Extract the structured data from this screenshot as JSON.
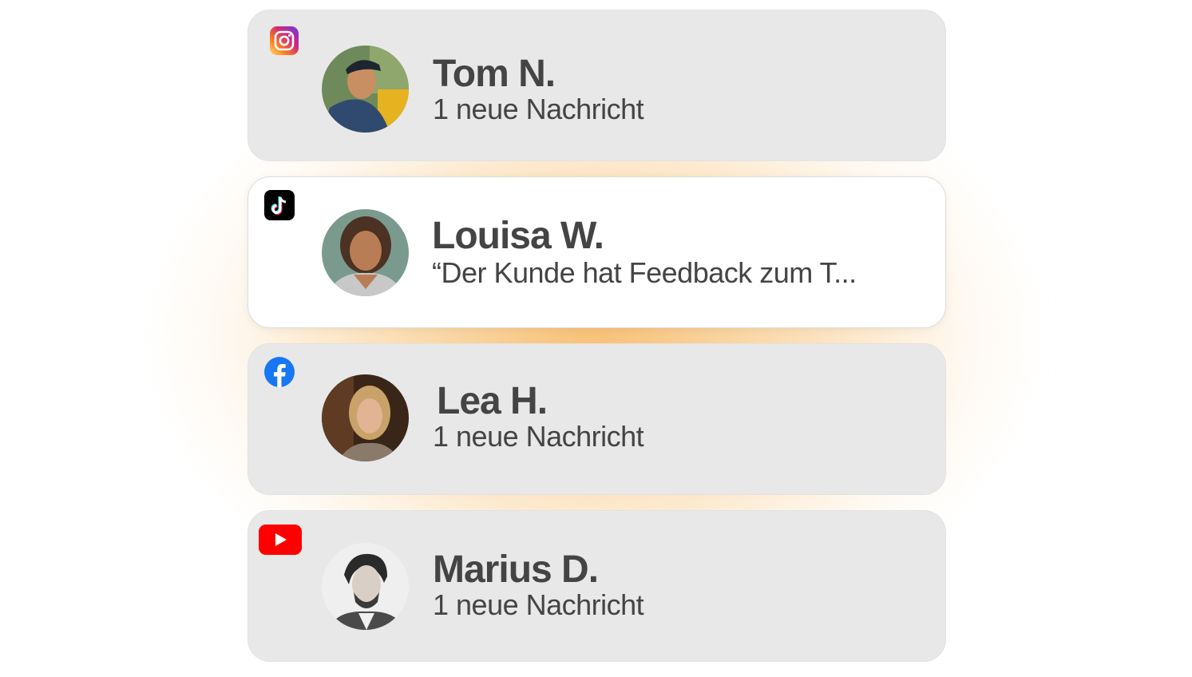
{
  "notifications": [
    {
      "app": "instagram",
      "app_icon": "instagram-icon",
      "name": "Tom N.",
      "message": "1 neue Nachricht",
      "active": false
    },
    {
      "app": "tiktok",
      "app_icon": "tiktok-icon",
      "name": "Louisa W.",
      "message": "“Der Kunde hat Feedback zum T...",
      "active": true
    },
    {
      "app": "facebook",
      "app_icon": "facebook-icon",
      "name": "Lea H.",
      "message": "1 neue Nachricht",
      "active": false
    },
    {
      "app": "youtube",
      "app_icon": "youtube-icon",
      "name": "Marius D.",
      "message": "1 neue Nachricht",
      "active": false
    }
  ],
  "colors": {
    "card_bg": "#e8e8e8",
    "card_active_bg": "#ffffff",
    "text": "#444444",
    "glow": "#f6b45a",
    "facebook": "#1877f2",
    "youtube": "#ff0000",
    "tiktok": "#000000"
  }
}
